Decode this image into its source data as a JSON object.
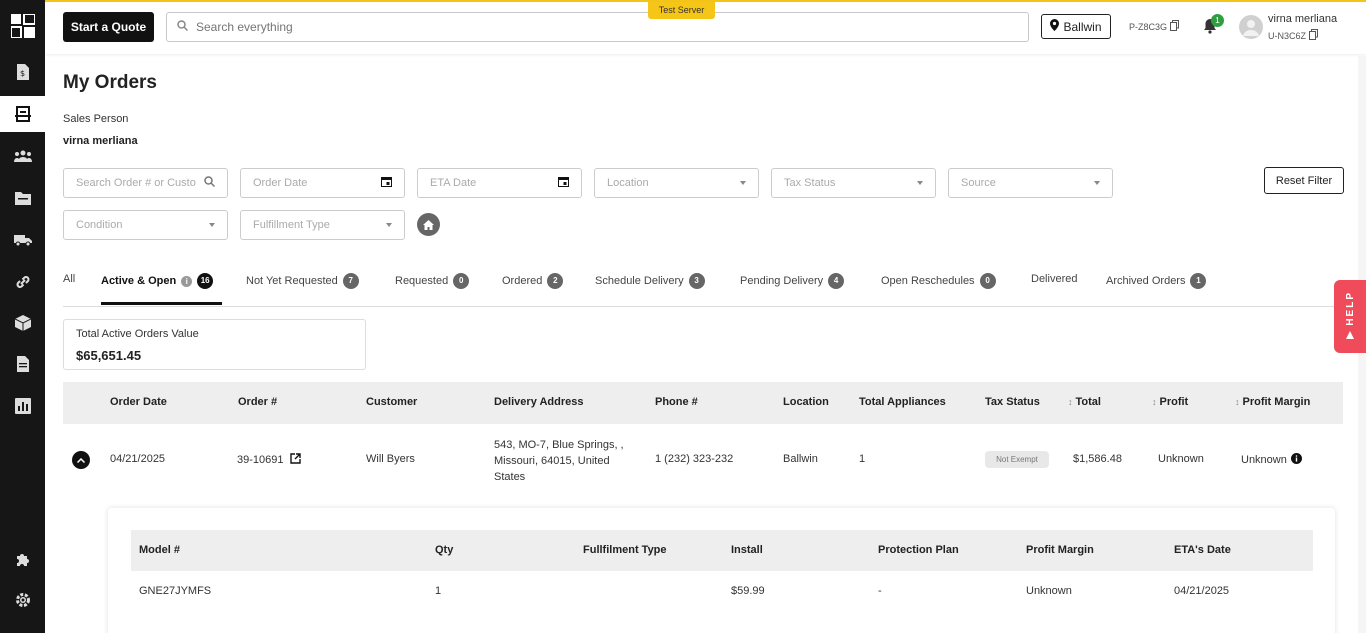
{
  "header": {
    "quote_button": "Start a Quote",
    "search_placeholder": "Search everything",
    "test_badge": "Test Server",
    "location": "Ballwin",
    "p_code": "P-Z8C3G",
    "notification_count": "1",
    "user_name": "virna merliana",
    "user_code": "U-N3C6Z"
  },
  "page": {
    "title": "My Orders",
    "sales_person_label": "Sales Person",
    "sales_person_name": "virna merliana"
  },
  "filters": {
    "search_placeholder": "Search Order # or Custo",
    "order_date": "Order Date",
    "eta_date": "ETA Date",
    "location": "Location",
    "tax_status": "Tax Status",
    "source": "Source",
    "condition": "Condition",
    "fulfillment_type": "Fulfillment Type",
    "reset": "Reset Filter"
  },
  "tabs": [
    {
      "label": "All",
      "count": ""
    },
    {
      "label": "Active & Open",
      "count": "16"
    },
    {
      "label": "Not Yet Requested",
      "count": "7"
    },
    {
      "label": "Requested",
      "count": "0"
    },
    {
      "label": "Ordered",
      "count": "2"
    },
    {
      "label": "Schedule Delivery",
      "count": "3"
    },
    {
      "label": "Pending Delivery",
      "count": "4"
    },
    {
      "label": "Open Reschedules",
      "count": "0"
    },
    {
      "label": "Delivered",
      "count": ""
    },
    {
      "label": "Archived Orders",
      "count": "1"
    }
  ],
  "summary": {
    "label": "Total Active Orders Value",
    "value": "$65,651.45"
  },
  "table": {
    "columns": [
      "Order Date",
      "Order #",
      "Customer",
      "Delivery Address",
      "Phone #",
      "Location",
      "Total Appliances",
      "Tax Status",
      "Total",
      "Profit",
      "Profit Margin"
    ],
    "rows": [
      {
        "order_date": "04/21/2025",
        "order_no": "39-10691",
        "customer": "Will Byers",
        "address_1": "543, MO-7, Blue Springs, ,",
        "address_2": "Missouri, 64015, United",
        "address_3": "States",
        "phone": "1 (232) 323-232",
        "location": "Ballwin",
        "total_appliances": "1",
        "tax_status": "Not Exempt",
        "total": "$1,586.48",
        "profit": "Unknown",
        "profit_margin": "Unknown"
      }
    ]
  },
  "detail": {
    "columns": [
      "Model #",
      "Qty",
      "Fullfilment Type",
      "Install",
      "Protection Plan",
      "Profit Margin",
      "ETA's Date"
    ],
    "rows": [
      {
        "model": "GNE27JYMFS",
        "qty": "1",
        "fulfillment": "",
        "install": "$59.99",
        "protection": "-",
        "profit_margin": "Unknown",
        "eta": "04/21/2025"
      }
    ]
  },
  "help": "HELP"
}
